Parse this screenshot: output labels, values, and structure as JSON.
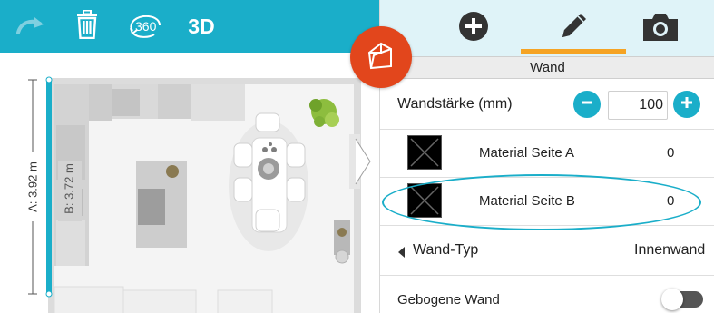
{
  "toolbar": {
    "undo_icon": "redo-arrow-icon",
    "delete_icon": "trash-icon",
    "view360_label": "360",
    "view3d_label": "3D"
  },
  "floorplan": {
    "dimension_outer": "A: 3.92 m",
    "dimension_inner": "B: 3.72 m"
  },
  "fab": {
    "icon": "wall-house-icon"
  },
  "tabs": [
    {
      "name": "add",
      "icon": "plus-circle-icon"
    },
    {
      "name": "edit",
      "icon": "pencil-icon",
      "active": true
    },
    {
      "name": "camera",
      "icon": "camera-icon"
    }
  ],
  "panel": {
    "section_title": "Wand",
    "wall_thickness_label": "Wandstärke (mm)",
    "wall_thickness_value": "100",
    "material_a_label": "Material Seite A",
    "material_a_value": "0",
    "material_b_label": "Material Seite B",
    "material_b_value": "0",
    "wall_type_label": "Wand-Typ",
    "wall_type_value": "Innenwand",
    "curved_wall_label": "Gebogene Wand",
    "curved_wall_enabled": false
  },
  "colors": {
    "accent": "#1aaec9",
    "fab": "#e2461c",
    "tab_indicator": "#f5a324",
    "tab_background": "#dff3f8"
  }
}
